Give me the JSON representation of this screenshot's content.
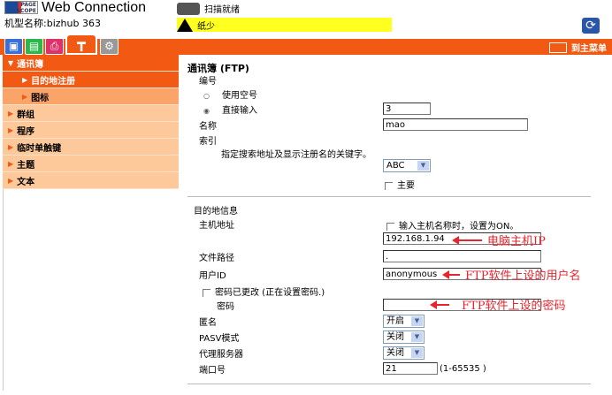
{
  "header": {
    "logo_small": "PAGE SCOPE",
    "logo_text": "Web Connection",
    "model": "机型名称:bizhub 363",
    "status_scan": "扫描就绪",
    "status_paper": "纸少",
    "refresh_icon": "refresh-icon"
  },
  "tabs": [
    {
      "icon": "box-icon",
      "color": "#3a6fd8"
    },
    {
      "icon": "document-icon",
      "color": "#2ab84a"
    },
    {
      "icon": "printer-icon",
      "color": "#e0306a"
    },
    {
      "icon": "mailbox-icon",
      "color": "#f25a14"
    },
    {
      "icon": "gear-box-icon",
      "color": "#999999"
    }
  ],
  "home_button": "到主菜单",
  "sidebar": {
    "items": [
      {
        "label": "通讯簿",
        "type": "top"
      },
      {
        "label": "目的地注册",
        "type": "sub"
      },
      {
        "label": "图标",
        "type": "sub2"
      },
      {
        "label": "群组"
      },
      {
        "label": "程序"
      },
      {
        "label": "临时单触键"
      },
      {
        "label": "主题"
      },
      {
        "label": "文本"
      }
    ]
  },
  "form": {
    "title": "通讯簿 (FTP)",
    "number_label": "编号",
    "use_empty": "使用空号",
    "direct_input": "直接输入",
    "number_value": "3",
    "name_label": "名称",
    "name_value": "mao",
    "index_label": "索引",
    "index_hint": "指定搜索地址及显示注册名的关键字。",
    "index_value": "ABC",
    "main_label": "主要",
    "dest_section": "目的地信息",
    "host_label": "主机地址",
    "host_checkbox": "输入主机名称时，设置为ON。",
    "host_value": "192.168.1.94",
    "path_label": "文件路径",
    "path_value": ".",
    "user_label": "用户ID",
    "user_value": "anonymous",
    "pw_changed": "密码已更改 (正在设置密码.)",
    "pw_label": "密码",
    "pw_value": "",
    "anon_label": "匿名",
    "anon_value": "开启",
    "pasv_label": "PASV模式",
    "pasv_value": "关闭",
    "proxy_label": "代理服务器",
    "proxy_value": "关闭",
    "port_label": "端口号",
    "port_value": "21",
    "port_range": "(1-65535 )"
  },
  "annotations": {
    "ip": "电脑主机IP",
    "user": "FTP软件上设的用户名",
    "pw": "FTP软件上设的密码"
  }
}
